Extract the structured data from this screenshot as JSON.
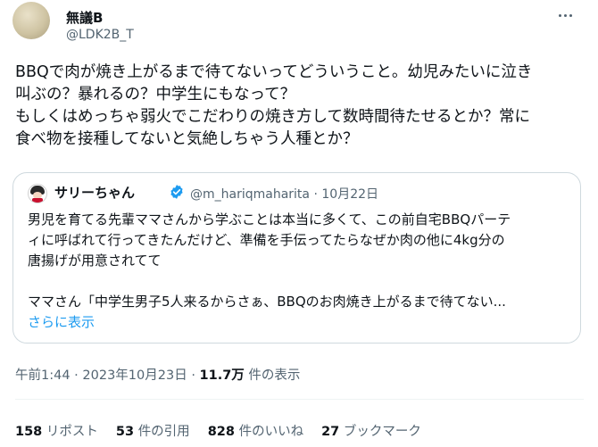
{
  "author": {
    "name": "無議B",
    "handle": "@LDK2B_T"
  },
  "tweet": {
    "lines": [
      "BBQで肉が焼き上がるまで待てないってどういうこと。幼児みたいに泣き",
      "叫ぶの？暴れるの？中学生にもなって？",
      "もしくはめっちゃ弱火でこだわりの焼き方して数時間待たせるとか？常に",
      "食べ物を接種してないと気絶しちゃう人種とか？"
    ]
  },
  "quote": {
    "name": "サリーちゃん",
    "handle": "@m_hariqmaharita",
    "separator": "·",
    "date": "10月22日",
    "lines": [
      "男児を育てる先輩ママさんから学ぶことは本当に多くて、この前自宅BBQパーテ",
      "ィに呼ばれて行ってきたんだけど、準備を手伝ってたらなぜか肉の他に4kg分の",
      "唐揚げが用意されてて",
      "ママさん「中学生男子5人来るからさぁ、BBQのお肉焼き上がるまで待てない..."
    ],
    "show_more": "さらに表示"
  },
  "meta": {
    "time": "午前1:44",
    "dot": "·",
    "date": "2023年10月23日",
    "views_count": "11.7万",
    "views_label": "件の表示"
  },
  "stats": {
    "retweets_count": "158",
    "retweets_label": "リポスト",
    "quotes_count": "53",
    "quotes_label": "件の引用",
    "likes_count": "828",
    "likes_label": "件のいいね",
    "bookmarks_count": "27",
    "bookmarks_label": "ブックマーク"
  },
  "icons": {
    "more": "more-horizontal-icon",
    "verified": "verified-badge-icon"
  },
  "colors": {
    "text": "#0f1419",
    "secondary": "#536471",
    "link": "#1d9bf0",
    "border": "#cfd9de"
  }
}
